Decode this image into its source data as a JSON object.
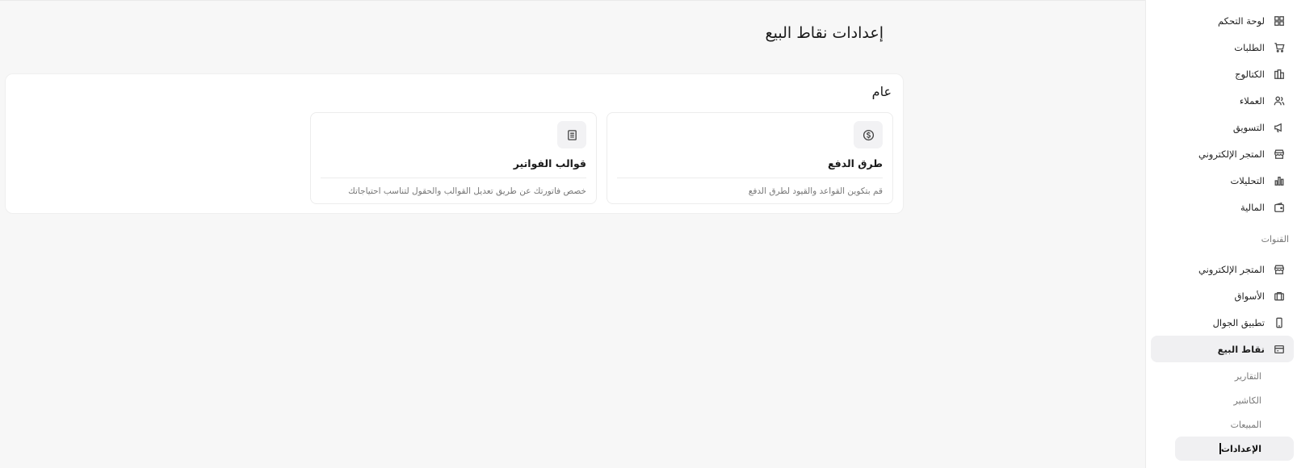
{
  "sidebar": {
    "items": [
      {
        "label": "لوحة التحكم",
        "icon": "dashboard-icon"
      },
      {
        "label": "الطلبات",
        "icon": "cart-icon"
      },
      {
        "label": "الكتالوج",
        "icon": "catalog-icon"
      },
      {
        "label": "العملاء",
        "icon": "users-icon"
      },
      {
        "label": "التسويق",
        "icon": "megaphone-icon"
      },
      {
        "label": "المتجر الإلكتروني",
        "icon": "store-icon"
      },
      {
        "label": "التحليلات",
        "icon": "bar-chart-icon"
      },
      {
        "label": "المالية",
        "icon": "wallet-icon"
      }
    ],
    "channels_title": "القنوات",
    "channels": [
      {
        "label": "المتجر الإلكتروني",
        "icon": "store-icon"
      },
      {
        "label": "الأسواق",
        "icon": "briefcase-icon"
      },
      {
        "label": "تطبيق الجوال",
        "icon": "mobile-icon"
      },
      {
        "label": "نقاط البيع",
        "icon": "pos-icon",
        "active": true
      }
    ],
    "pos_subitems": [
      {
        "label": "التقارير"
      },
      {
        "label": "الكاشير"
      },
      {
        "label": "المبيعات"
      },
      {
        "label": "الإعدادات",
        "active": true
      }
    ]
  },
  "page": {
    "title": "إعدادات نقاط البيع"
  },
  "general": {
    "title": "عام",
    "cards": [
      {
        "title": "طرق الدفع",
        "description": "قم بتكوين القواعد والقيود لطرق الدفع",
        "icon": "dollar-circle-icon"
      },
      {
        "title": "قوالب الفواتير",
        "description": "خصص فاتورتك عن طريق تعديل القوالب والحقول لتناسب احتياجاتك",
        "icon": "document-icon"
      }
    ]
  },
  "colors": {
    "background": "#f7f7f7",
    "panel": "#ffffff",
    "active_bg": "#f0f0f2"
  }
}
